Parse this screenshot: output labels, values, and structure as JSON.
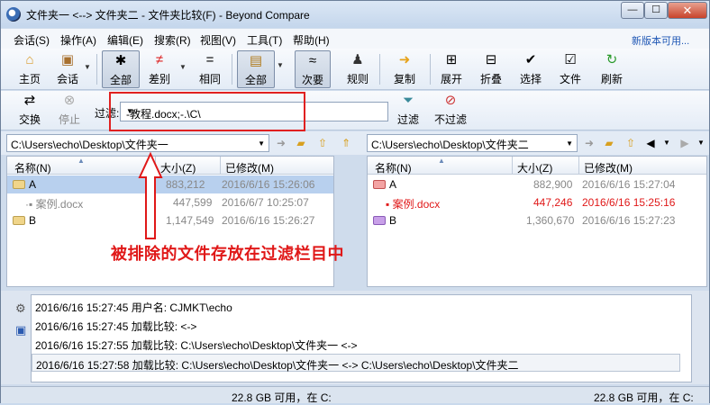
{
  "window": {
    "title": "文件夹一 <--> 文件夹二 - 文件夹比较(F) - Beyond Compare",
    "min": "—",
    "max": "☐",
    "close": "✕"
  },
  "menu": {
    "items": [
      "会话(S)",
      "操作(A)",
      "编辑(E)",
      "搜索(R)",
      "视图(V)",
      "工具(T)",
      "帮助(H)"
    ],
    "promo": "新版本可用..."
  },
  "toolbar": {
    "home": "主页",
    "sessions": "会话",
    "all": "全部",
    "diffs": "差别",
    "same": "相同",
    "all2": "全部",
    "minor": "次要",
    "rules": "规则",
    "copy": "复制",
    "expand": "展开",
    "collapse": "折叠",
    "select": "选择",
    "files": "文件",
    "refresh": "刷新"
  },
  "toolbar2": {
    "swap": "交换",
    "stop": "停止",
    "filter_label": "过滤:",
    "filter_value": "-教程.docx;-.\\C\\",
    "filter_btn": "过滤",
    "nofilter_btn": "不过滤"
  },
  "left": {
    "path": "C:\\Users\\echo\\Desktop\\文件夹一",
    "headers": {
      "name": "名称(N)",
      "size": "大小(Z)",
      "modified": "已修改(M)"
    },
    "rows": [
      {
        "name": "A",
        "size": "883,212",
        "date": "2016/6/16 15:26:06"
      },
      {
        "name": "案例.docx",
        "size": "447,599",
        "date": "2016/6/7 10:25:07"
      },
      {
        "name": "B",
        "size": "1,147,549",
        "date": "2016/6/16 15:26:27"
      }
    ]
  },
  "right": {
    "path": "C:\\Users\\echo\\Desktop\\文件夹二",
    "headers": {
      "name": "名称(N)",
      "size": "大小(Z)",
      "modified": "已修改(M)"
    },
    "rows": [
      {
        "name": "A",
        "size": "882,900",
        "date": "2016/6/16 15:27:04"
      },
      {
        "name": "案例.docx",
        "size": "447,246",
        "date": "2016/6/16 15:25:16"
      },
      {
        "name": "B",
        "size": "1,360,670",
        "date": "2016/6/16 15:27:23"
      }
    ]
  },
  "log": [
    "2016/6/16 15:27:45  用户名: CJMKT\\echo",
    "2016/6/16 15:27:45  加载比较:  <->",
    "2016/6/16 15:27:55  加载比较: C:\\Users\\echo\\Desktop\\文件夹一 <->",
    "2016/6/16 15:27:58  加载比较: C:\\Users\\echo\\Desktop\\文件夹一 <-> C:\\Users\\echo\\Desktop\\文件夹二"
  ],
  "status": {
    "left": "22.8 GB 可用，在 C:",
    "right": "22.8 GB 可用，在 C:"
  },
  "annotation": "被排除的文件存放在过滤栏目中",
  "colors": {
    "diff": "#e01818",
    "accent": "#1f57b5"
  }
}
